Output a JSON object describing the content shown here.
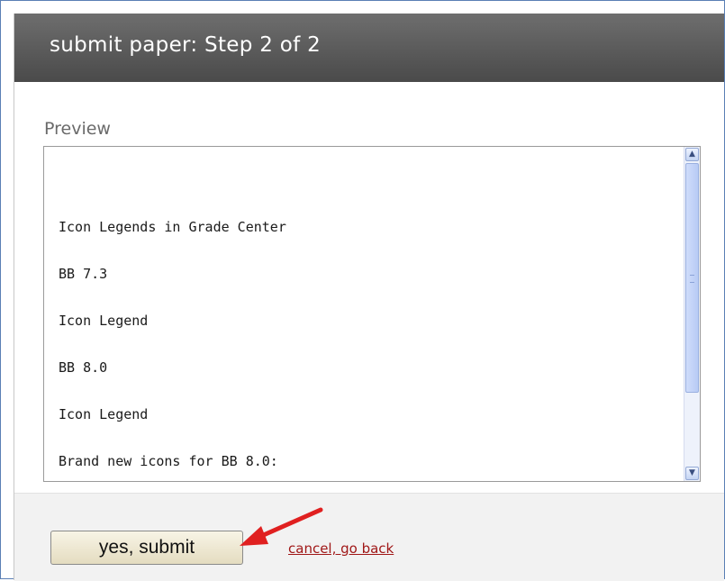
{
  "header": {
    "title": "submit paper: Step 2 of 2"
  },
  "preview": {
    "label": "Preview",
    "lines": [
      "Icon Legends in Grade Center",
      "BB 7.3",
      "Icon Legend",
      "BB 8.0",
      "Icon Legend",
      "Brand new icons for BB 8.0:"
    ]
  },
  "footer": {
    "submit_label": "yes, submit",
    "cancel_label": "cancel, go back"
  },
  "colors": {
    "header_bg": "#555555",
    "cancel_link": "#a01818",
    "annotation_arrow": "#e02020"
  },
  "icons": {
    "scroll_up": "scroll-up-arrow-icon",
    "scroll_down": "scroll-down-arrow-icon",
    "annotation": "red-arrow-annotation-icon"
  }
}
